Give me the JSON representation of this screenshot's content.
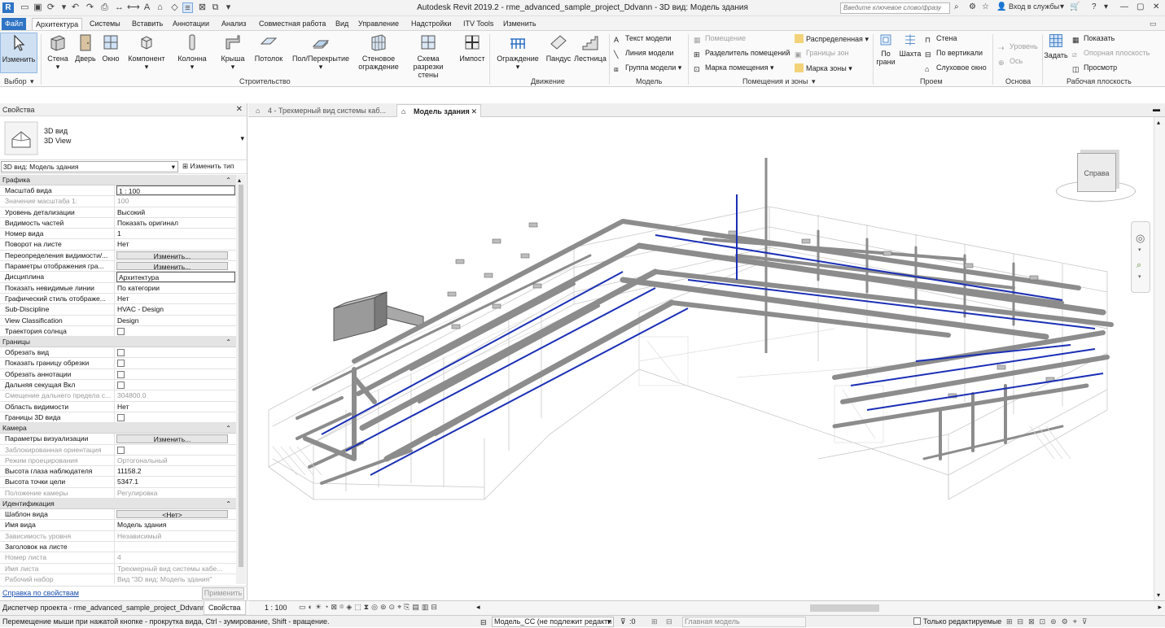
{
  "window": {
    "title": "Autodesk Revit 2019.2 - rme_advanced_sample_project_Ddvann - 3D вид: Модель здания"
  },
  "titlebar": {
    "search_placeholder": "Введите ключевое слово/фразу",
    "signin": "Вход в службы"
  },
  "tabs": [
    "Файл",
    "Архитектура",
    "Системы",
    "Вставить",
    "Аннотации",
    "Анализ",
    "Совместная работа",
    "Вид",
    "Управление",
    "Надстройки",
    "ITV Tools",
    "Изменить"
  ],
  "ribbon": {
    "select": {
      "label": "Изменить",
      "group": "Выбор"
    },
    "build": {
      "wall": "Стена",
      "door": "Дверь",
      "window": "Окно",
      "component": "Компонент",
      "column": "Колонна",
      "roof": "Крыша",
      "ceiling": "Потолок",
      "floor": "Пол/Перекрытие",
      "curtain_wall": "Стеновое ограждение",
      "curtain_grid": "Схема разрезки стены",
      "mullion": "Импост",
      "group": "Строительство"
    },
    "circulation": {
      "railing": "Ограждение",
      "ramp": "Пандус",
      "stair": "Лестница",
      "group": "Движение"
    },
    "model": {
      "text": "Текст модели",
      "line": "Линия модели",
      "group_model": "Группа модели",
      "group": "Модель"
    },
    "rooms": {
      "room": "Помещение",
      "room_sep": "Разделитель помещений",
      "room_tag": "Марка помещения",
      "area": "Распределенная",
      "area_bound": "Границы зон",
      "area_tag": "Марка зоны",
      "group": "Помещения и зоны"
    },
    "opening": {
      "by_face": "По грани",
      "shaft": "Шахта",
      "wall": "Стена",
      "vertical": "По вертикали",
      "dormer": "Слуховое окно",
      "group": "Проем"
    },
    "datum": {
      "level": "Уровень",
      "grid": "Ось",
      "group": "Основа"
    },
    "workplane": {
      "set": "Задать",
      "show": "Показать",
      "ref_plane": "Опорная плоскость",
      "viewer": "Просмотр",
      "group": "Рабочая плоскость"
    }
  },
  "properties": {
    "title": "Свойства",
    "type_name": "3D вид",
    "type_name2": "3D View",
    "instance_selector": "3D вид: Модель здания",
    "edit_type": "Изменить тип",
    "categories": [
      {
        "name": "Графика",
        "rows": [
          {
            "k": "Масштаб вида",
            "v": "1 : 100",
            "t": "input"
          },
          {
            "k": "Значение масштаба    1:",
            "v": "100",
            "ro": true
          },
          {
            "k": "Уровень детализации",
            "v": "Высокий"
          },
          {
            "k": "Видимость частей",
            "v": "Показать оригинал"
          },
          {
            "k": "Номер вида",
            "v": "1"
          },
          {
            "k": "Поворот на листе",
            "v": "Нет"
          },
          {
            "k": "Переопределения видимости/...",
            "v": "Изменить...",
            "t": "btn"
          },
          {
            "k": "Параметры отображения гра...",
            "v": "Изменить...",
            "t": "btn"
          },
          {
            "k": "Дисциплина",
            "v": "Архитектура",
            "t": "input"
          },
          {
            "k": "Показать невидимые линии",
            "v": "По категории"
          },
          {
            "k": "Графический стиль отображе...",
            "v": "Нет"
          },
          {
            "k": "Sub-Discipline",
            "v": "HVAC - Design"
          },
          {
            "k": "View Classification",
            "v": "Design"
          },
          {
            "k": "Траектория солнца",
            "v": "",
            "t": "chk"
          }
        ]
      },
      {
        "name": "Границы",
        "rows": [
          {
            "k": "Обрезать вид",
            "v": "",
            "t": "chk"
          },
          {
            "k": "Показать границу обрезки",
            "v": "",
            "t": "chk"
          },
          {
            "k": "Обрезать аннотации",
            "v": "",
            "t": "chk"
          },
          {
            "k": "Дальняя секущая Вкл",
            "v": "",
            "t": "chk"
          },
          {
            "k": "Смещение дальнего предела с...",
            "v": "304800.0",
            "ro": true
          },
          {
            "k": "Область видимости",
            "v": "Нет"
          },
          {
            "k": "Границы 3D вида",
            "v": "",
            "t": "chk"
          }
        ]
      },
      {
        "name": "Камера",
        "rows": [
          {
            "k": "Параметры визуализации",
            "v": "Изменить...",
            "t": "btn"
          },
          {
            "k": "Заблокированная ориентация",
            "v": "",
            "t": "chk",
            "ro": true
          },
          {
            "k": "Режим проецирования",
            "v": "Ортогональный",
            "ro": true
          },
          {
            "k": "Высота глаза наблюдателя",
            "v": "11158.2"
          },
          {
            "k": "Высота точки цели",
            "v": "5347.1"
          },
          {
            "k": "Положение камеры",
            "v": "Регулировка",
            "ro": true
          }
        ]
      },
      {
        "name": "Идентификация",
        "rows": [
          {
            "k": "Шаблон вида",
            "v": "<Нет>",
            "t": "btn"
          },
          {
            "k": "Имя вида",
            "v": "Модель здания"
          },
          {
            "k": "Зависимость уровня",
            "v": "Независимый",
            "ro": true
          },
          {
            "k": "Заголовок на листе",
            "v": ""
          },
          {
            "k": "Номер листа",
            "v": "4",
            "ro": true
          },
          {
            "k": "Имя листа",
            "v": "Трехмерный вид системы кабе...",
            "ro": true
          },
          {
            "k": "Рабочий набор",
            "v": "Вид \"3D вид: Модель здания\"",
            "ro": true
          }
        ]
      }
    ],
    "help_link": "Справка по свойствам",
    "apply": "Применить"
  },
  "bottom_tabs": {
    "browser": "Диспетчер проекта - rme_advanced_sample_project_Ddvann",
    "props": "Свойства"
  },
  "view_tabs": [
    {
      "label": "4 - Трехмерный вид системы каб..."
    },
    {
      "label": "Модель здания"
    }
  ],
  "viewcube": {
    "face": "Справа"
  },
  "view_control": {
    "scale": "1 : 100"
  },
  "status": {
    "hint": "Перемещение мыши при нажатой кнопке - прокрутка вида, Ctrl - зумирование, Shift - вращение.",
    "workset": "Модель_CC (не подлежит редакти",
    "selection_count": ":0",
    "design_option": "Главная модель",
    "editable_only": "Только редактируемые"
  },
  "colors": {
    "file_tab": "#2e73c4",
    "duct": "#8c8c8c",
    "pipe": "#1a2fb5",
    "link": "#1a4fb0"
  }
}
